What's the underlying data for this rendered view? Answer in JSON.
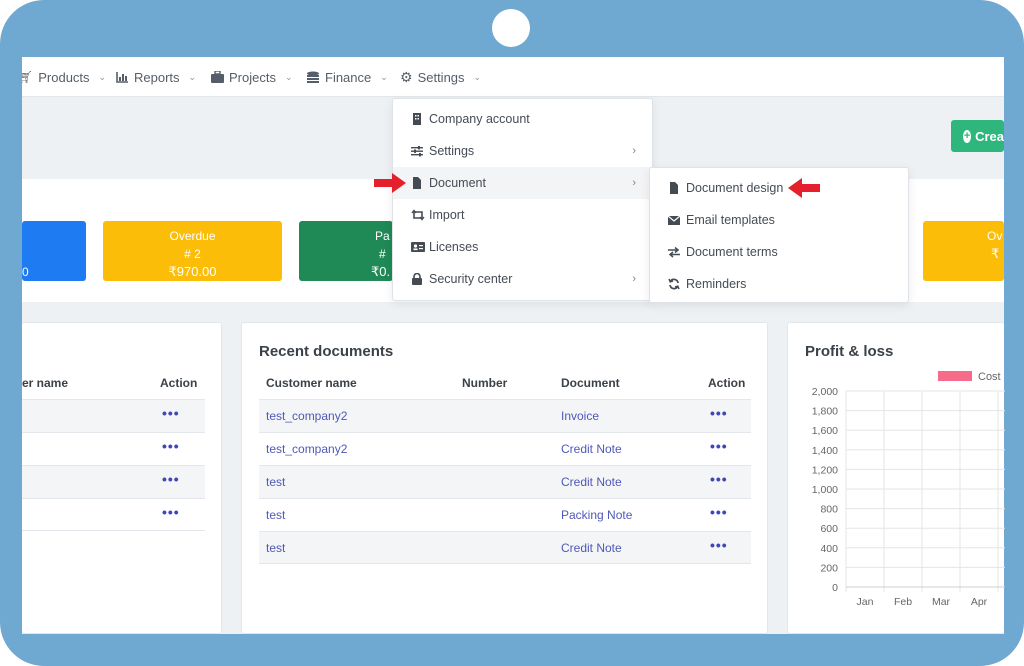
{
  "navbar": {
    "items": [
      {
        "label": "Products",
        "icon": "cart-icon"
      },
      {
        "label": "Reports",
        "icon": "chart-icon"
      },
      {
        "label": "Projects",
        "icon": "briefcase-icon"
      },
      {
        "label": "Finance",
        "icon": "coins-icon"
      },
      {
        "label": "Settings",
        "icon": "gear-icon"
      }
    ]
  },
  "header": {
    "create_label": "Crea"
  },
  "stats": [
    {
      "title": "",
      "count": "",
      "amount": "0",
      "color": "#1e7bf2"
    },
    {
      "title": "Overdue",
      "count": "# 2",
      "amount": "₹970.00",
      "color": "#fbbd08"
    },
    {
      "title": "Pa",
      "count": "#",
      "amount": "₹0.",
      "color": "#1f8a55"
    },
    {
      "title": "Ov",
      "count": "",
      "amount": "₹",
      "color": "#fbbd08"
    }
  ],
  "left_card": {
    "headers": {
      "customer": "er name",
      "action": "Action"
    },
    "rows": 4
  },
  "recent": {
    "title": "Recent documents",
    "headers": {
      "customer": "Customer name",
      "number": "Number",
      "document": "Document",
      "action": "Action"
    },
    "rows": [
      {
        "customer": "test_company2",
        "number": "",
        "document": "Invoice"
      },
      {
        "customer": "test_company2",
        "number": "",
        "document": "Credit Note"
      },
      {
        "customer": "test",
        "number": "",
        "document": "Credit Note"
      },
      {
        "customer": "test",
        "number": "",
        "document": "Packing Note"
      },
      {
        "customer": "test",
        "number": "",
        "document": "Credit Note"
      }
    ]
  },
  "settings_menu": {
    "items": [
      {
        "label": "Company account",
        "icon": "building-icon",
        "submenu": false
      },
      {
        "label": "Settings",
        "icon": "sliders-icon",
        "submenu": true
      },
      {
        "label": "Document",
        "icon": "file-icon",
        "submenu": true,
        "active": true
      },
      {
        "label": "Import",
        "icon": "retweet-icon",
        "submenu": false
      },
      {
        "label": "Licenses",
        "icon": "id-card-icon",
        "submenu": false
      },
      {
        "label": "Security center",
        "icon": "lock-icon",
        "submenu": true
      }
    ]
  },
  "document_submenu": {
    "items": [
      {
        "label": "Document design",
        "icon": "file-icon"
      },
      {
        "label": "Email templates",
        "icon": "envelope-icon"
      },
      {
        "label": "Document terms",
        "icon": "exchange-icon"
      },
      {
        "label": "Reminders",
        "icon": "refresh-icon"
      }
    ]
  },
  "profit_loss": {
    "title": "Profit & loss",
    "chart_data": {
      "type": "bar",
      "title": "",
      "categories": [
        "Jan",
        "Feb",
        "Mar",
        "Apr"
      ],
      "series": [
        {
          "name": "Cost",
          "values": [
            0,
            0,
            0,
            0
          ],
          "color": "#f76b8a"
        }
      ],
      "ylim": [
        0,
        2000
      ],
      "yticks": [
        "0",
        "200",
        "400",
        "600",
        "800",
        "1,000",
        "1,200",
        "1,400",
        "1,600",
        "1,800",
        "2,000"
      ],
      "grid": true,
      "legend": "top-right"
    }
  },
  "colors": {
    "accent_link": "#4f58b8",
    "create_green": "#2eb67d",
    "annotation_red": "#e3202b"
  }
}
